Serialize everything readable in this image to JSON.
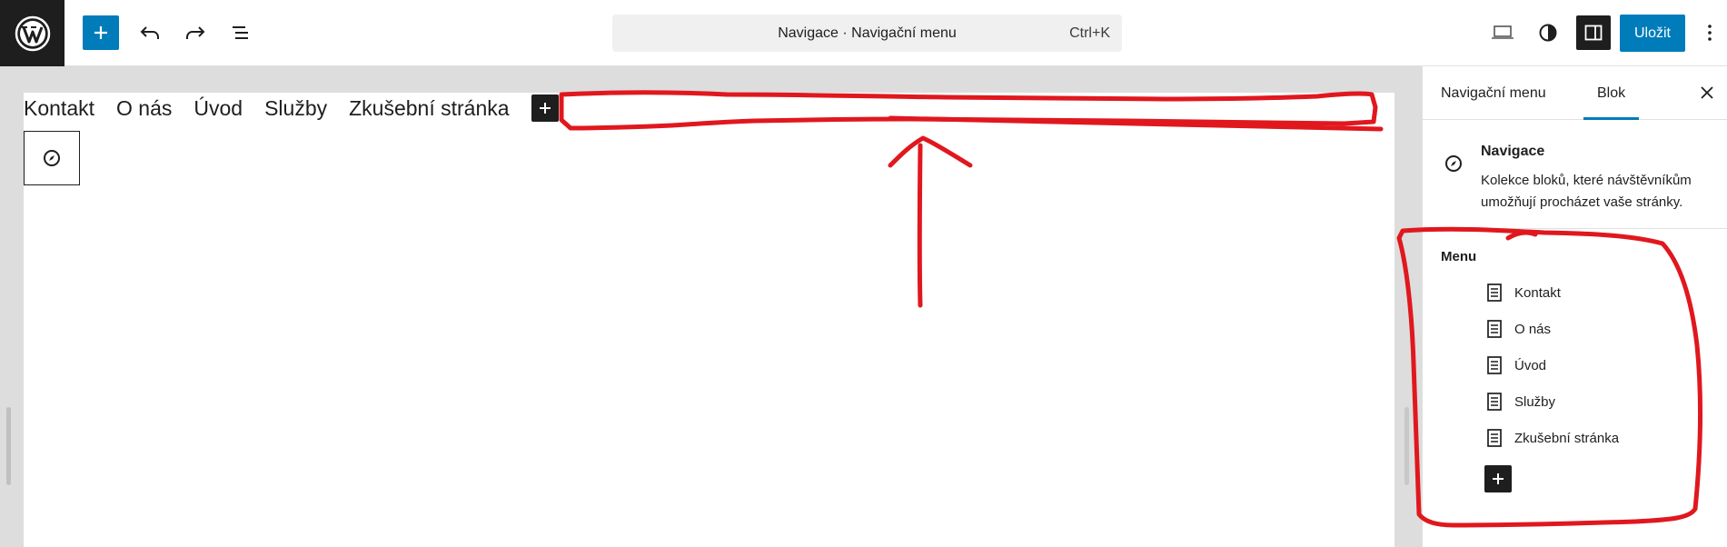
{
  "toolbar": {
    "icons": [
      "wordpress-logo",
      "plus-icon",
      "undo-icon",
      "redo-icon",
      "document-overview-icon"
    ],
    "command_bar": {
      "title": "Navigace · Navigační menu",
      "shortcut": "Ctrl+K"
    },
    "right_icons": [
      "desktop-view-icon",
      "styles-icon",
      "sidebar-settings-icon",
      "more-options-icon"
    ],
    "save_label": "Uložit"
  },
  "canvas": {
    "nav_items": [
      "Kontakt",
      "O nás",
      "Úvod",
      "Služby",
      "Zkušební stránka"
    ]
  },
  "sidebar": {
    "tabs": [
      {
        "label": "Navigační menu",
        "active": false
      },
      {
        "label": "Blok",
        "active": true
      }
    ],
    "block": {
      "title": "Navigace",
      "description": "Kolekce bloků, které návštěvníkům umožňují procházet vaše stránky."
    },
    "menu": {
      "heading": "Menu",
      "items": [
        "Kontakt",
        "O nás",
        "Úvod",
        "Služby",
        "Zkušební stránka"
      ]
    }
  },
  "colors": {
    "accent": "#007cba",
    "dark": "#1e1e1e",
    "annotation": "#e0181e"
  }
}
